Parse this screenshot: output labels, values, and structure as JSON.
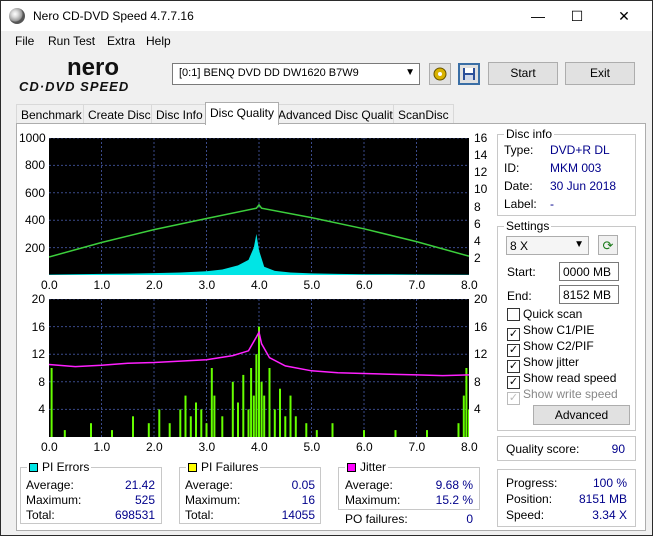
{
  "window": {
    "title": "Nero CD-DVD Speed 4.7.7.16",
    "minimize": "—",
    "maximize": "☐",
    "close": "✕"
  },
  "menu": [
    "File",
    "Run Test",
    "Extra",
    "Help"
  ],
  "logo": {
    "top": "nero",
    "bottom": "CD·DVD SPEED"
  },
  "toolbar": {
    "drive": "[0:1]   BENQ DVD DD DW1620 B7W9",
    "start": "Start",
    "exit": "Exit",
    "eject_icon": "eject-icon",
    "save_icon": "save-icon"
  },
  "tabs": [
    "Benchmark",
    "Create Disc",
    "Disc Info",
    "Disc Quality",
    "Advanced Disc Quality",
    "ScanDisc"
  ],
  "active_tab": "Disc Quality",
  "chart_data": [
    {
      "type": "area",
      "name": "PI Errors / read speed",
      "x_ticks": [
        "0.0",
        "1.0",
        "2.0",
        "3.0",
        "4.0",
        "5.0",
        "6.0",
        "7.0",
        "8.0"
      ],
      "y_left_ticks": [
        "1000",
        "800",
        "600",
        "400",
        "200"
      ],
      "y_right_ticks": [
        "16",
        "14",
        "12",
        "10",
        "8",
        "6",
        "4",
        "2"
      ],
      "xlim": [
        0,
        8.0
      ],
      "ylim_left": [
        0,
        1000
      ],
      "ylim_right": [
        0,
        16
      ],
      "series": [
        {
          "color": "#00e5e5",
          "points": [
            [
              0,
              3
            ],
            [
              0.5,
              5
            ],
            [
              1.0,
              8
            ],
            [
              1.5,
              10
            ],
            [
              2.0,
              14
            ],
            [
              2.5,
              18
            ],
            [
              3.0,
              28
            ],
            [
              3.3,
              40
            ],
            [
              3.6,
              70
            ],
            [
              3.8,
              110
            ],
            [
              3.9,
              200
            ],
            [
              3.95,
              300
            ],
            [
              4.0,
              180
            ],
            [
              4.1,
              60
            ],
            [
              4.3,
              30
            ],
            [
              4.6,
              18
            ],
            [
              5.0,
              12
            ],
            [
              5.5,
              8
            ],
            [
              6.0,
              6
            ],
            [
              6.5,
              5
            ],
            [
              7.0,
              4
            ],
            [
              7.5,
              3
            ],
            [
              8.0,
              2
            ]
          ]
        },
        {
          "color": "#3ccf3c",
          "points": [
            [
              0,
              2.1
            ],
            [
              1.0,
              3.8
            ],
            [
              2.0,
              5.3
            ],
            [
              3.0,
              6.6
            ],
            [
              3.95,
              7.8
            ],
            [
              4.0,
              8.2
            ],
            [
              4.05,
              7.8
            ],
            [
              5.0,
              6.7
            ],
            [
              6.0,
              5.4
            ],
            [
              7.0,
              3.9
            ],
            [
              8.0,
              2.2
            ]
          ]
        }
      ],
      "grid": true
    },
    {
      "type": "bar",
      "name": "PI Failures / jitter",
      "x_ticks": [
        "0.0",
        "1.0",
        "2.0",
        "3.0",
        "4.0",
        "5.0",
        "6.0",
        "7.0",
        "8.0"
      ],
      "y_left_ticks": [
        "20",
        "16",
        "12",
        "8",
        "4"
      ],
      "y_right_ticks": [
        "20",
        "16",
        "12",
        "8",
        "4"
      ],
      "xlim": [
        0,
        8.0
      ],
      "ylim_left": [
        0,
        20
      ],
      "ylim_right": [
        0,
        20
      ],
      "series": [
        {
          "color": "#66ff00",
          "points": [
            [
              0.05,
              10
            ],
            [
              0.3,
              1
            ],
            [
              0.8,
              2
            ],
            [
              1.2,
              1
            ],
            [
              1.6,
              3
            ],
            [
              1.9,
              2
            ],
            [
              2.1,
              4
            ],
            [
              2.3,
              2
            ],
            [
              2.5,
              4
            ],
            [
              2.6,
              6
            ],
            [
              2.7,
              3
            ],
            [
              2.8,
              5
            ],
            [
              2.9,
              4
            ],
            [
              3.0,
              2
            ],
            [
              3.1,
              10
            ],
            [
              3.15,
              6
            ],
            [
              3.3,
              3
            ],
            [
              3.5,
              8
            ],
            [
              3.6,
              5
            ],
            [
              3.7,
              9
            ],
            [
              3.8,
              4
            ],
            [
              3.85,
              10
            ],
            [
              3.9,
              6
            ],
            [
              3.95,
              12
            ],
            [
              4.0,
              16
            ],
            [
              4.05,
              8
            ],
            [
              4.1,
              6
            ],
            [
              4.2,
              10
            ],
            [
              4.3,
              4
            ],
            [
              4.4,
              7
            ],
            [
              4.5,
              3
            ],
            [
              4.6,
              6
            ],
            [
              4.7,
              3
            ],
            [
              4.9,
              2
            ],
            [
              5.1,
              1
            ],
            [
              5.4,
              2
            ],
            [
              6.0,
              1
            ],
            [
              6.6,
              1
            ],
            [
              7.2,
              1
            ],
            [
              7.8,
              2
            ],
            [
              7.9,
              6
            ],
            [
              7.95,
              10
            ],
            [
              8.0,
              4
            ]
          ]
        },
        {
          "color": "#ff20ff",
          "points": [
            [
              0,
              10.5
            ],
            [
              0.5,
              10.2
            ],
            [
              1.0,
              10.4
            ],
            [
              1.5,
              10.7
            ],
            [
              2.0,
              10.8
            ],
            [
              2.5,
              11.0
            ],
            [
              3.0,
              11.2
            ],
            [
              3.5,
              11.8
            ],
            [
              3.8,
              12.5
            ],
            [
              3.95,
              14.5
            ],
            [
              4.0,
              15.2
            ],
            [
              4.05,
              13.5
            ],
            [
              4.2,
              11.5
            ],
            [
              4.5,
              10.3
            ],
            [
              5.0,
              9.6
            ],
            [
              5.5,
              9.3
            ],
            [
              6.0,
              9.2
            ],
            [
              6.5,
              9.1
            ],
            [
              7.0,
              9.0
            ],
            [
              7.5,
              8.9
            ],
            [
              8.0,
              9.0
            ]
          ]
        }
      ],
      "grid": true
    }
  ],
  "disc_info": {
    "header": "Disc info",
    "type_label": "Type:",
    "type": "DVD+R DL",
    "id_label": "ID:",
    "id": "MKM 003",
    "date_label": "Date:",
    "date": "30 Jun 2018",
    "label_label": "Label:",
    "label": "-"
  },
  "settings": {
    "header": "Settings",
    "speed": "8 X",
    "start_label": "Start:",
    "start": "0000 MB",
    "end_label": "End:",
    "end": "8152 MB",
    "advanced": "Advanced"
  },
  "checks": [
    {
      "label": "Quick scan",
      "checked": false,
      "enabled": true
    },
    {
      "label": "Show C1/PIE",
      "checked": true,
      "enabled": true
    },
    {
      "label": "Show C2/PIF",
      "checked": true,
      "enabled": true
    },
    {
      "label": "Show jitter",
      "checked": true,
      "enabled": true
    },
    {
      "label": "Show read speed",
      "checked": true,
      "enabled": true
    },
    {
      "label": "Show write speed",
      "checked": true,
      "enabled": false
    }
  ],
  "quality": {
    "label": "Quality score:",
    "value": "90"
  },
  "progress": {
    "progress_label": "Progress:",
    "progress": "100 %",
    "position_label": "Position:",
    "position": "8151 MB",
    "speed_label": "Speed:",
    "speed": "3.34 X"
  },
  "pi_errors": {
    "header": "PI Errors",
    "color": "#00e5e5",
    "avg_label": "Average:",
    "avg": "21.42",
    "max_label": "Maximum:",
    "max": "525",
    "total_label": "Total:",
    "total": "698531"
  },
  "pi_failures": {
    "header": "PI Failures",
    "color": "#ffff00",
    "avg_label": "Average:",
    "avg": "0.05",
    "max_label": "Maximum:",
    "max": "16",
    "total_label": "Total:",
    "total": "14055"
  },
  "jitter": {
    "header": "Jitter",
    "color": "#ff00ff",
    "avg_label": "Average:",
    "avg": "9.68 %",
    "max_label": "Maximum:",
    "max": "15.2 %",
    "po_label": "PO failures:",
    "po": "0"
  }
}
